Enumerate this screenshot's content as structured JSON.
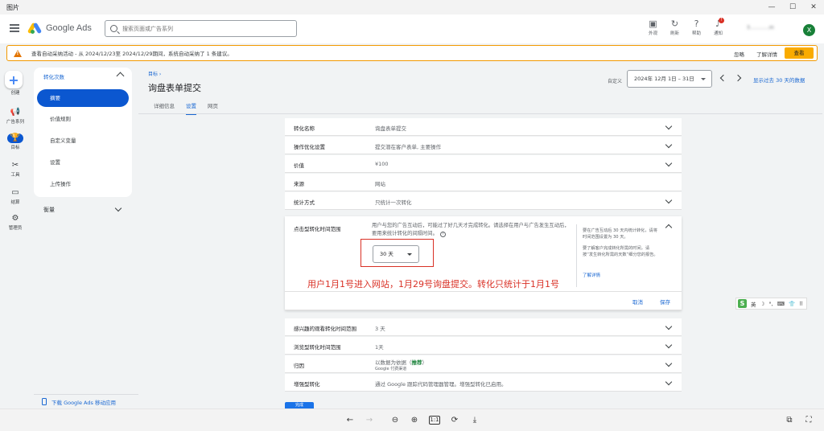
{
  "window": {
    "title": "图片"
  },
  "header": {
    "brand": "Google Ads",
    "search_placeholder": "搜索页面或广告系列",
    "tools": [
      {
        "icon": "appearance-icon",
        "label": "外观"
      },
      {
        "icon": "refresh-icon",
        "label": "刷新"
      },
      {
        "icon": "help-icon",
        "label": "帮助"
      },
      {
        "icon": "bell-icon",
        "label": "通知",
        "badge": "!"
      }
    ],
    "account_id": "3…………m",
    "avatar_letter": "X"
  },
  "alert": {
    "message": "查看自动采纳活动 - 从 2024/12/23至 2024/12/29期间，系统自动采纳了 1 条建议。",
    "ignore_label": "忽略",
    "learn_label": "了解详情",
    "view_label": "查看"
  },
  "rail": {
    "items": [
      {
        "icon": "plus-icon",
        "label": "创建"
      },
      {
        "icon": "megaphone-icon",
        "label": "广告系列"
      },
      {
        "icon": "trophy-icon",
        "label": "目标"
      },
      {
        "icon": "tools-icon",
        "label": "工具"
      },
      {
        "icon": "billing-icon",
        "label": "结算"
      },
      {
        "icon": "gear-icon",
        "label": "管理员"
      }
    ]
  },
  "nav": {
    "section": "转化次数",
    "items": [
      "摘要",
      "价值规则",
      "自定义变量",
      "设置",
      "上传操作"
    ],
    "measure": "衡量",
    "download_app": "下载 Google Ads 移动应用"
  },
  "page": {
    "breadcrumb": "目标 ›",
    "title": "询盘表单提交",
    "tabs": [
      "详细信息",
      "设置",
      "网页"
    ],
    "date_label": "自定义",
    "date_range": "2024年 12月 1日 – 31日",
    "past30": "显示过去 30 天的数据"
  },
  "settings": {
    "rows_top": [
      {
        "key": "转化名称",
        "value": "询盘表单提交"
      },
      {
        "key": "操作优化设置",
        "value": "提交潜在客户表单, 主要操作"
      },
      {
        "key": "价值",
        "value": "¥100"
      },
      {
        "key": "来源",
        "value": "网站"
      },
      {
        "key": "统计方式",
        "value": "只统计一次转化"
      }
    ],
    "expanded": {
      "key": "点击型转化时间范围",
      "description": "用户与您的广告互动后，可能过了好几天才完成转化。请选择在用户与广告发生互动后，要用来统计转化的间隔时间。",
      "help_icon": "?",
      "days_value": "30 天",
      "annotation": "用户1月1号进入网站，1月29号询盘提交。转化只统计于1月1号",
      "side_note_1": "要在广告互动后 30 天内统计转化，请将时间范围设置为 30 天。",
      "side_note_2": "要了解客户完成转化所需的时间，请按“发生转化所需的天数”细分您的报告。",
      "learn_more": "了解详情",
      "cancel": "取消",
      "save": "保存"
    },
    "rows_bottom": [
      {
        "key": "感兴趣的观看转化时间范围",
        "value": "3 天"
      },
      {
        "key": "浏览型转化时间范围",
        "value": "1天"
      },
      {
        "key": "归因",
        "value": "以数据为依据（",
        "value_rec": "推荐",
        "value_tail": "）",
        "sub": "Google 付费渠道"
      },
      {
        "key": "增强型转化",
        "value": "通过 Google 跟踪代码管理器管理。增强型转化已启用。"
      }
    ],
    "done_label": "完成"
  },
  "ime": {
    "logo": "S",
    "items": [
      "英",
      "☽",
      "°,",
      "⌨",
      "👕",
      "⠿"
    ]
  },
  "viewer": {
    "buttons": [
      "←",
      "→",
      "⊖",
      "⊕",
      "1:1",
      "⟳",
      "⤓",
      "⧉",
      "⛶"
    ]
  }
}
